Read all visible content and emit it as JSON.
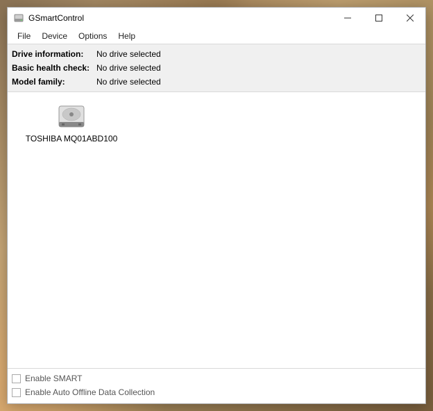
{
  "window": {
    "title": "GSmartControl"
  },
  "menu": {
    "file": "File",
    "device": "Device",
    "options": "Options",
    "help": "Help"
  },
  "info": {
    "drive_info_label": "Drive information:",
    "drive_info_value": "No drive selected",
    "health_label": "Basic health check:",
    "health_value": "No drive selected",
    "model_label": "Model family:",
    "model_value": "No drive selected"
  },
  "drives": [
    {
      "label": "TOSHIBA MQ01ABD100"
    }
  ],
  "footer": {
    "enable_smart": "Enable SMART",
    "enable_offline": "Enable Auto Offline Data Collection"
  }
}
